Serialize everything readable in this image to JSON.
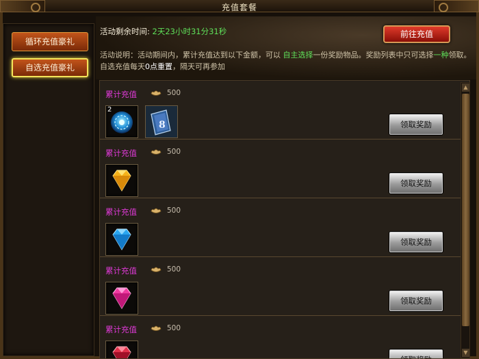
{
  "window": {
    "title": "充值套餐"
  },
  "nav": {
    "items": [
      {
        "label": "循环充值豪礼",
        "active": false
      },
      {
        "label": "自选充值豪礼",
        "active": true
      }
    ]
  },
  "header": {
    "timer_label": "活动剩余时间:",
    "timer_value": "2天23小时31分31秒",
    "go_button": "前往充值",
    "desc_prefix": "活动说明：活动期间内，累计充值达到以下金额，可以",
    "desc_hl1": "自主选择",
    "desc_mid1": "一份奖励物品。奖励列表中只可选择",
    "desc_hl2": "一种",
    "desc_mid2": "领取。自选充值每天",
    "desc_hl3": "0点重置",
    "desc_suffix": "，隔天可再参加"
  },
  "rewards": [
    {
      "label": "累计充值",
      "amount": "500",
      "button": "领取奖励",
      "items": [
        {
          "icon": "blue-orb-icon",
          "count": "2"
        },
        {
          "icon": "skill-book-icon",
          "count": ""
        }
      ]
    },
    {
      "label": "累计充值",
      "amount": "500",
      "button": "领取奖励",
      "items": [
        {
          "icon": "yellow-gem-icon",
          "count": ""
        }
      ]
    },
    {
      "label": "累计充值",
      "amount": "500",
      "button": "领取奖励",
      "items": [
        {
          "icon": "blue-gem-icon",
          "count": ""
        }
      ]
    },
    {
      "label": "累计充值",
      "amount": "500",
      "button": "领取奖励",
      "items": [
        {
          "icon": "pink-gem-icon",
          "count": ""
        }
      ]
    },
    {
      "label": "累计充值",
      "amount": "500",
      "button": "领取奖励",
      "items": [
        {
          "icon": "red-gem-icon",
          "count": ""
        }
      ]
    }
  ],
  "colors": {
    "accent_green": "#5fe05a",
    "label_magenta": "#e03ad8",
    "go_button_red": "#e03a2a"
  }
}
